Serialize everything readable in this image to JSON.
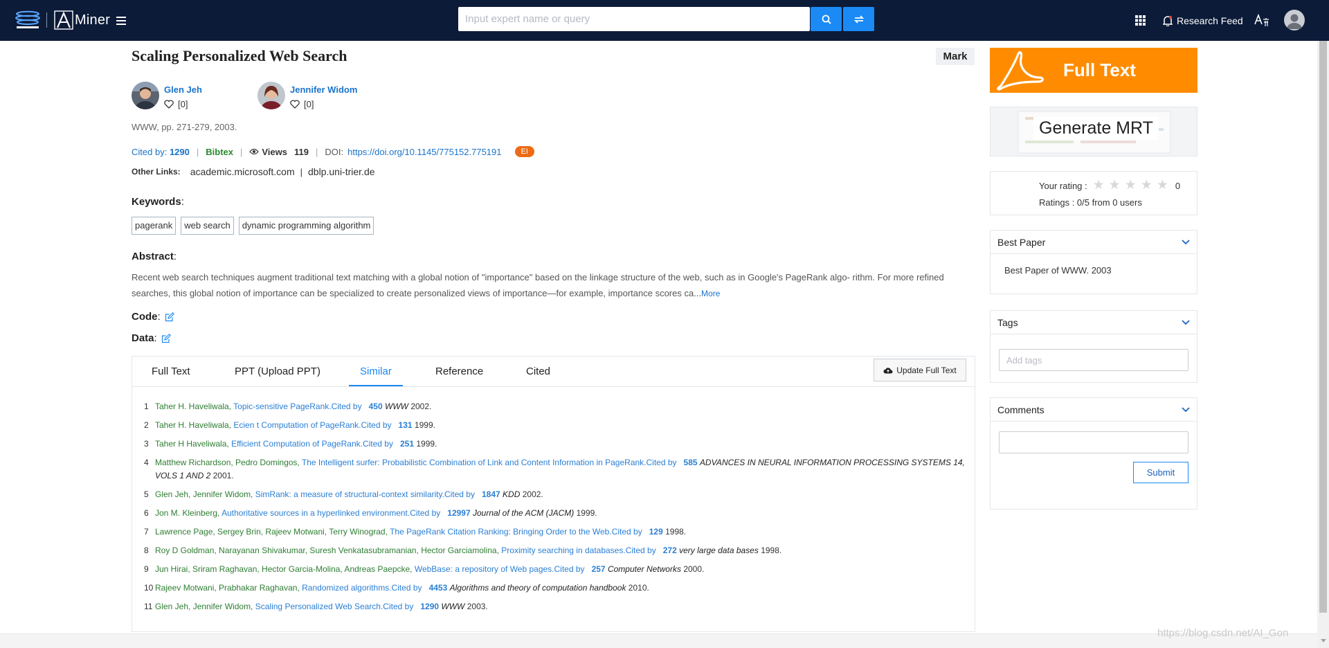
{
  "header": {
    "search_placeholder": "Input expert name or query",
    "research_feed": "Research Feed",
    "icons": [
      "search-icon",
      "switch-icon",
      "apps-icon",
      "bell-icon",
      "translate-icon",
      "user-icon"
    ],
    "accent_color": "#1b8af5",
    "bar_color": "#0c1b38",
    "logo_text": "Miner"
  },
  "paper": {
    "title": "Scaling Personalized Web Search",
    "mark_label": "Mark",
    "authors": [
      {
        "name": "Glen Jeh",
        "likes": "[0]"
      },
      {
        "name": "Jennifer Widom",
        "likes": "[0]"
      }
    ],
    "venue": "WWW, pp. 271-279, 2003.",
    "cited_label": "Cited by:",
    "cited_count": "1290",
    "bibtex": "Bibtex",
    "views_label": "Views",
    "views_count": "119",
    "doi_label": "DOI:",
    "doi": "https://doi.org/10.1145/775152.775191",
    "ei_badge": "EI",
    "other_links_label": "Other Links:",
    "other_links": [
      "academic.microsoft.com",
      "dblp.uni-trier.de"
    ],
    "keywords_label": "Keywords",
    "keywords": [
      "pagerank",
      "web search",
      "dynamic programming algorithm"
    ],
    "abstract_label": "Abstract",
    "abstract": "Recent web search techniques augment traditional text matching with a global notion of \"importance\" based on the linkage structure of the web, such as in Google's PageRank algo- rithm. For more refined searches, this global notion of importance can be specialized to create personalized views of importance—for example, importance scores ca...",
    "more_label": "More",
    "code_label": "Code",
    "data_label": "Data"
  },
  "tabs": {
    "items": [
      "Full Text",
      "PPT (Upload PPT)",
      "Similar",
      "Reference",
      "Cited"
    ],
    "active": "Similar",
    "update_label": "Update Full Text"
  },
  "similar": [
    {
      "num": "1",
      "authors": "Taher H. Haveliwala,",
      "title": "Topic-sensitive PageRank.",
      "cited_label": "Cited by",
      "cited": "450",
      "venue": "WWW",
      "year": "2002."
    },
    {
      "num": "2",
      "authors": "Taher H. Haveliwala,",
      "title": "Ecien t Computation of PageRank.",
      "cited_label": "Cited by",
      "cited": "131",
      "venue": "",
      "year": "1999."
    },
    {
      "num": "3",
      "authors": "Taher H Haveliwala,",
      "title": "Efficient Computation of PageRank.",
      "cited_label": "Cited by",
      "cited": "251",
      "venue": "",
      "year": "1999."
    },
    {
      "num": "4",
      "authors": "Matthew Richardson, Pedro Domingos,",
      "title": "The Intelligent surfer: Probabilistic Combination of Link and Content Information in PageRank.",
      "cited_label": "Cited by",
      "cited": "585",
      "venue": "ADVANCES IN NEURAL INFORMATION PROCESSING SYSTEMS 14, VOLS 1 AND 2",
      "year": "2001."
    },
    {
      "num": "5",
      "authors": "Glen Jeh, Jennifer Widom,",
      "title": "SimRank: a measure of structural-context similarity.",
      "cited_label": "Cited by",
      "cited": "1847",
      "venue": "KDD",
      "year": "2002."
    },
    {
      "num": "6",
      "authors": "Jon M. Kleinberg,",
      "title": "Authoritative sources in a hyperlinked environment.",
      "cited_label": "Cited by",
      "cited": "12997",
      "venue": "Journal of the ACM (JACM)",
      "year": "1999."
    },
    {
      "num": "7",
      "authors": "Lawrence Page, Sergey Brin, Rajeev Motwani, Terry Winograd,",
      "title": "The PageRank Citation Ranking: Bringing Order to the Web.",
      "cited_label": "Cited by",
      "cited": "129",
      "venue": "",
      "year": "1998."
    },
    {
      "num": "8",
      "authors": "Roy D Goldman, Narayanan Shivakumar, Suresh Venkatasubramanian, Hector Garciamolina,",
      "title": "Proximity searching in databases.",
      "cited_label": "Cited by",
      "cited": "272",
      "venue": "very large data bases",
      "year": "1998."
    },
    {
      "num": "9",
      "authors": "Jun Hirai, Sriram Raghavan, Hector Garcia-Molina, Andreas Paepcke,",
      "title": "WebBase: a repository of Web pages.",
      "cited_label": "Cited by",
      "cited": "257",
      "venue": "Computer Networks",
      "year": "2000."
    },
    {
      "num": "10",
      "authors": "Rajeev Motwani, Prabhakar Raghavan,",
      "title": "Randomized algorithms.",
      "cited_label": "Cited by",
      "cited": "4453",
      "venue": "Algorithms and theory of computation handbook",
      "year": "2010."
    },
    {
      "num": "11",
      "authors": "Glen Jeh, Jennifer Widom,",
      "title": "Scaling Personalized Web Search.",
      "cited_label": "Cited by",
      "cited": "1290",
      "venue": "WWW",
      "year": "2003."
    }
  ],
  "sidebar": {
    "full_text": "Full Text",
    "generate_mrt": "Generate MRT",
    "rating_label": "Your rating :",
    "rating_value": "0",
    "stars_filled": 0,
    "stars_total": 5,
    "ratings_summary": "Ratings : 0/5 from 0 users",
    "best_paper_title": "Best Paper",
    "best_paper_text": "Best Paper of WWW. 2003",
    "tags_title": "Tags",
    "tags_placeholder": "Add tags",
    "comments_title": "Comments",
    "submit_label": "Submit",
    "full_text_color": "#ff8c00"
  },
  "watermark": "https://blog.csdn.net/AI_Gon"
}
